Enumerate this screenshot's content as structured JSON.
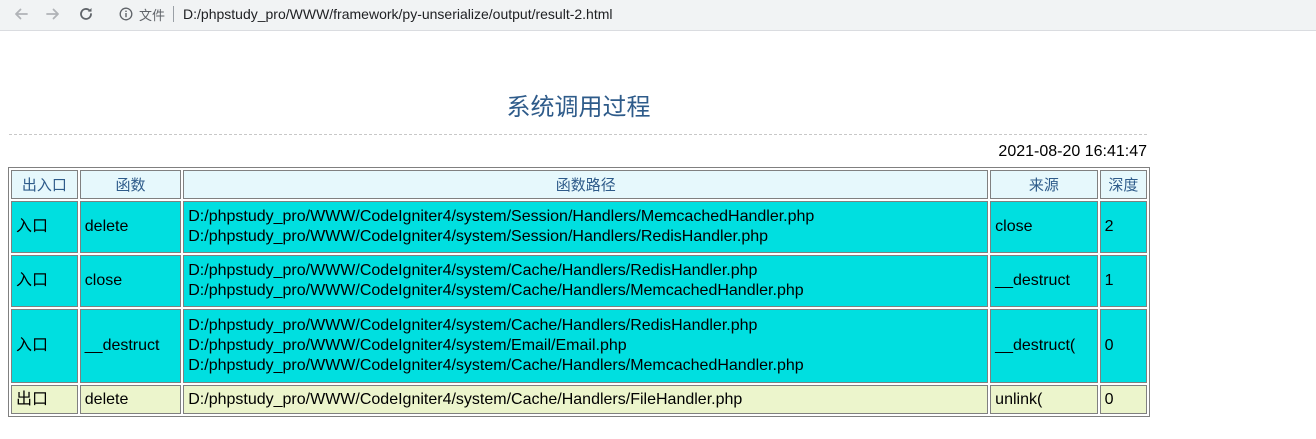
{
  "browser": {
    "scheme_label": "文件",
    "url": "D:/phpstudy_pro/WWW/framework/py-unserialize/output/result-2.html"
  },
  "report": {
    "title": "系统调用过程",
    "timestamp": "2021-08-20 16:41:47",
    "headers": {
      "direction": "出入口",
      "function": "函数",
      "path": "函数路径",
      "source": "来源",
      "depth": "深度"
    },
    "rows": [
      {
        "type": "enter",
        "direction": "入口",
        "function": "delete",
        "paths": [
          "D:/phpstudy_pro/WWW/CodeIgniter4/system/Session/Handlers/MemcachedHandler.php",
          "D:/phpstudy_pro/WWW/CodeIgniter4/system/Session/Handlers/RedisHandler.php"
        ],
        "source": "close",
        "depth": "2"
      },
      {
        "type": "enter",
        "direction": "入口",
        "function": "close",
        "paths": [
          "D:/phpstudy_pro/WWW/CodeIgniter4/system/Cache/Handlers/RedisHandler.php",
          "D:/phpstudy_pro/WWW/CodeIgniter4/system/Cache/Handlers/MemcachedHandler.php"
        ],
        "source": "__destruct",
        "depth": "1"
      },
      {
        "type": "enter",
        "direction": "入口",
        "function": "__destruct",
        "paths": [
          "D:/phpstudy_pro/WWW/CodeIgniter4/system/Cache/Handlers/RedisHandler.php",
          "D:/phpstudy_pro/WWW/CodeIgniter4/system/Email/Email.php",
          "D:/phpstudy_pro/WWW/CodeIgniter4/system/Cache/Handlers/MemcachedHandler.php"
        ],
        "source": "__destruct(",
        "depth": "0"
      },
      {
        "type": "exit",
        "direction": "出口",
        "function": "delete",
        "paths": [
          "D:/phpstudy_pro/WWW/CodeIgniter4/system/Cache/Handlers/FileHandler.php"
        ],
        "source": "unlink(",
        "depth": "0"
      }
    ]
  },
  "colors": {
    "title": "#2e5b8a",
    "header_bg": "#e6f8fc",
    "enter_row_bg": "#00dfe0",
    "exit_row_bg": "#ecf5cc"
  },
  "icons": {
    "back": "arrow-left-icon",
    "forward": "arrow-right-icon",
    "reload": "reload-icon",
    "info": "info-icon"
  }
}
